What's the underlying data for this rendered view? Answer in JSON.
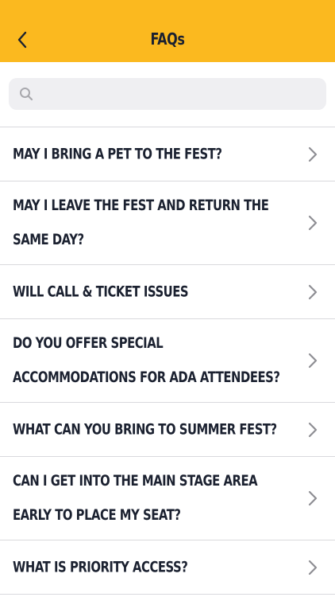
{
  "header": {
    "title": "FAQs",
    "back_icon": "chevron-left-icon",
    "background": "#fbb91f"
  },
  "search": {
    "placeholder": "",
    "value": "",
    "icon": "search-icon"
  },
  "faqs": [
    {
      "question": "May I bring a pet to the fest?"
    },
    {
      "question": "May I leave the fest and return the same day?"
    },
    {
      "question": "Will call & ticket issues"
    },
    {
      "question": "Do you offer special accommodations for ADA attendees?"
    },
    {
      "question": "What can you bring to Summer Fest?"
    },
    {
      "question": "Can I get into the main stage area early to place my seat?"
    },
    {
      "question": "What is priority access?"
    }
  ],
  "colors": {
    "accent": "#fbb91f",
    "text": "#1b2130",
    "divider": "#d9d9dd",
    "chevron": "#8e8e93",
    "search_bg": "#efeff2"
  }
}
